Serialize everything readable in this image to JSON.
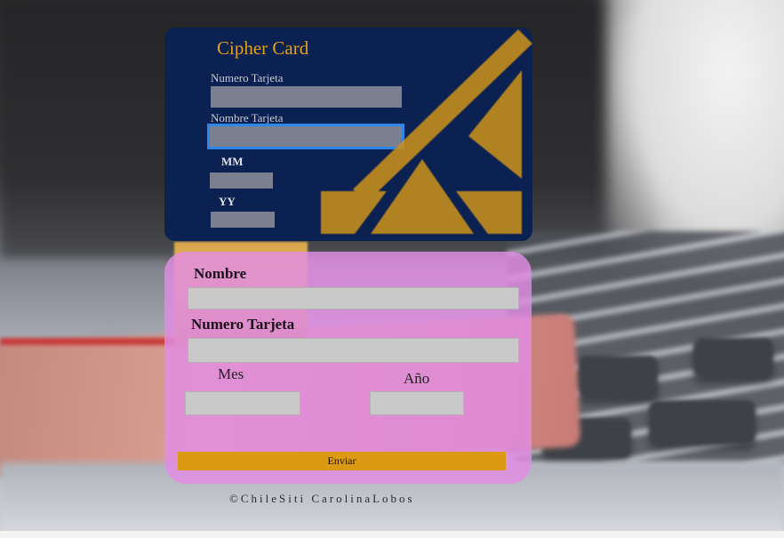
{
  "card_preview": {
    "title": "Cipher Card",
    "number_label": "Numero Tarjeta",
    "name_label": "Nombre Tarjeta",
    "month_label": "MM",
    "year_label": "YY",
    "logo_icon": "gold-chevron-triangle-logo",
    "colors": {
      "background": "#0b2151",
      "accent": "#c8901c",
      "focus": "#2e86e8"
    }
  },
  "form": {
    "name_label": "Nombre",
    "name_value": "",
    "number_label": "Numero Tarjeta",
    "number_value": "",
    "month_label": "Mes",
    "month_value": "",
    "year_label": "Año",
    "year_value": "",
    "submit_label": "Enviar",
    "colors": {
      "panel": "#e28ce4",
      "button": "#dc9a14"
    }
  },
  "footer": {
    "text": "©ChileSiti CarolinaLobos"
  }
}
